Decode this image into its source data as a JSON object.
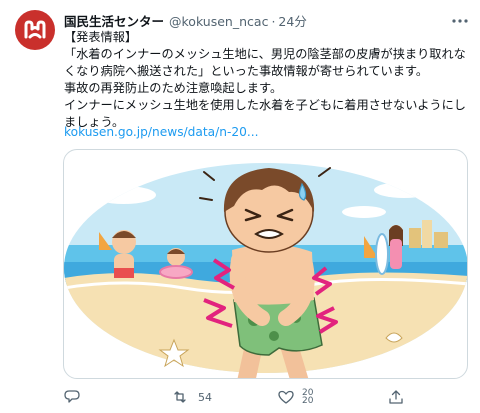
{
  "tweet": {
    "display_name": "国民生活センター",
    "handle": "@kokusen_ncac",
    "separator": "·",
    "timestamp": "24分",
    "body_lines": [
      "【発表情報】",
      "「水着のインナーのメッシュ生地に、男児の陰茎部の皮膚が挟まり取れな",
      "くなり病院へ搬送された」といった事故情報が寄せられています。",
      "事故の再発防止のため注意喚起します。",
      "インナーにメッシュ生地を使用した水着を子どもに着用させないようにし",
      "ましょう。"
    ],
    "link_text": "kokusen.go.jp/news/data/n-20...",
    "image_alt": "水着のメッシュ生地に皮膚が挟まり痛がる男の子のイラスト"
  },
  "actions": {
    "reply_count": "",
    "retweet_count": "54",
    "like_count_top": "20",
    "like_count_bottom": "20",
    "share_count": ""
  },
  "colors": {
    "brand_red": "#c9302c",
    "link_blue": "#1d9bf0",
    "muted_gray": "#536471",
    "border": "#cfd9de"
  },
  "icons": {
    "avatar": "kokusen-logo",
    "more": "more-horizontal-icon",
    "reply": "reply-icon",
    "retweet": "retweet-icon",
    "like": "heart-icon",
    "share": "share-icon"
  }
}
